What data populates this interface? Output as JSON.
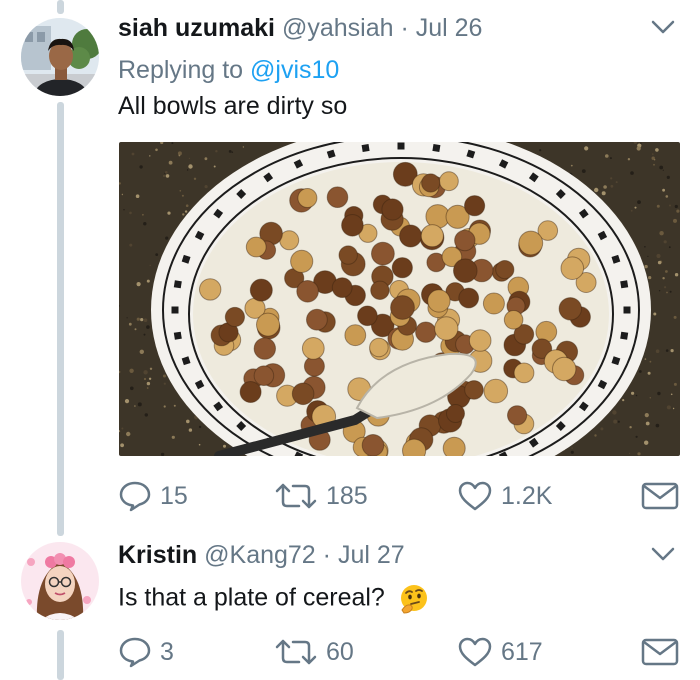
{
  "tweets": [
    {
      "author_name": "siah uzumaki",
      "author_handle": "@yahsiah",
      "separator": "·",
      "date": "Jul 26",
      "reply_prefix": "Replying to",
      "reply_mention": "@jvis10",
      "text": "All bowls are dirty so",
      "media": "photo of a plate of chocolate and vanilla cereal balls in milk with a spoon",
      "replies": "15",
      "retweets": "185",
      "likes": "1.2K"
    },
    {
      "author_name": "Kristin",
      "author_handle": "@Kang72",
      "separator": "·",
      "date": "Jul 27",
      "text": "Is that a plate of cereal?",
      "emoji": "thinking-face",
      "replies": "3",
      "retweets": "60",
      "likes": "617"
    }
  ],
  "colors": {
    "link_blue": "#1da1f2",
    "meta_gray": "#657786",
    "thread_line": "#ccd6dd",
    "text": "#14171a"
  },
  "icons": [
    "reply-icon",
    "retweet-icon",
    "like-icon",
    "direct-message-icon",
    "chevron-down-icon"
  ]
}
